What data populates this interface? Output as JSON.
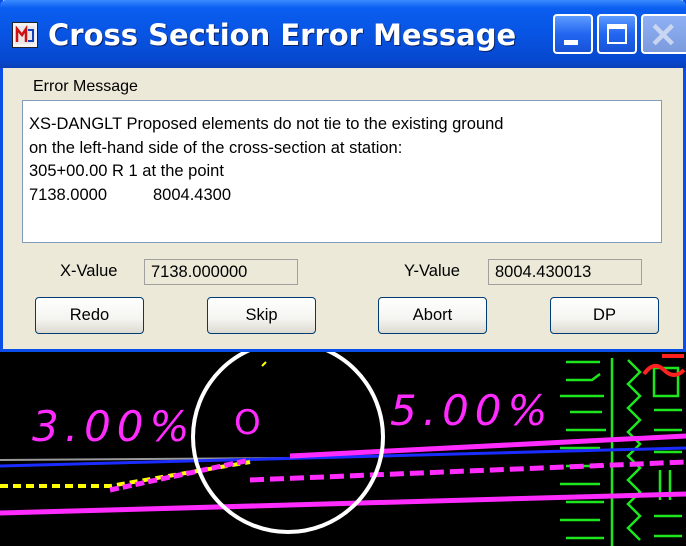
{
  "window": {
    "title": "Cross Section Error Message",
    "app_icon": "microstation-app-icon",
    "controls": [
      "minimize-icon",
      "maximize-icon",
      "close-icon"
    ]
  },
  "dialog": {
    "group_label": "Error Message",
    "message_lines": [
      "XS-DANGLT Proposed elements do not tie to the existing ground",
      "on the left-hand side of the cross-section at station:",
      "305+00.00 R 1 at the point"
    ],
    "coord_x": "7138.0000",
    "coord_y": "8004.4300",
    "x_label": "X-Value",
    "x_value": "7138.000000",
    "y_label": "Y-Value",
    "y_value": "8004.430013",
    "buttons": {
      "redo": "Redo",
      "skip": "Skip",
      "abort": "Abort",
      "dp": "DP"
    }
  },
  "cad_view": {
    "left_slope_label": "3.00%",
    "right_slope_label": "5.00%",
    "marker_label": "O",
    "colors": {
      "background": "#000000",
      "magenta": "#ff2bff",
      "green": "#1ee61e",
      "blue": "#1a2cff",
      "yellow": "#ffff00",
      "white": "#ffffff",
      "red": "#ff2020"
    }
  }
}
